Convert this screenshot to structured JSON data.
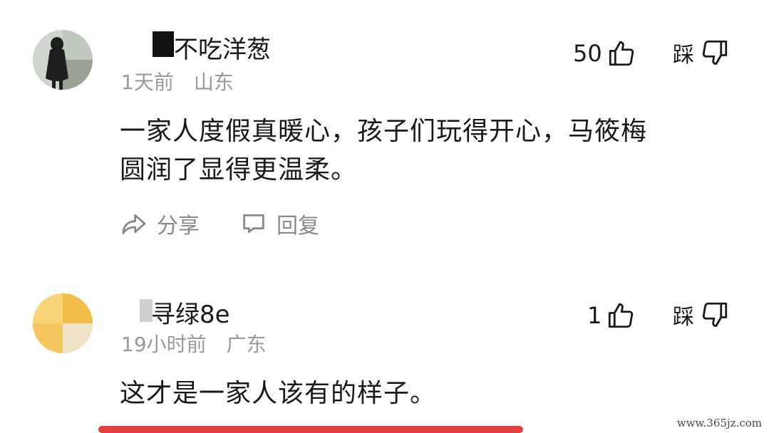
{
  "comments": [
    {
      "username_visible": "不吃洋葱",
      "time": "1天前",
      "location": "山东",
      "like_count": "50",
      "dislike_label": "踩",
      "text_line1": "一家人度假真暖心，孩子们玩得开心，马筱梅",
      "text_line2": "圆润了显得更温柔。",
      "share_label": "分享",
      "reply_label": "回复"
    },
    {
      "username_visible": "寻绿8e",
      "time": "19小时前",
      "location": "广东",
      "like_count": "1",
      "dislike_label": "踩",
      "text_line1": "这才是一家人该有的样子。"
    }
  ],
  "watermark": "www.365jz.com",
  "colors": {
    "text": "#1a1a1a",
    "meta": "#9a9a9a",
    "action": "#8a8a8a",
    "underline": "#e2413f"
  }
}
